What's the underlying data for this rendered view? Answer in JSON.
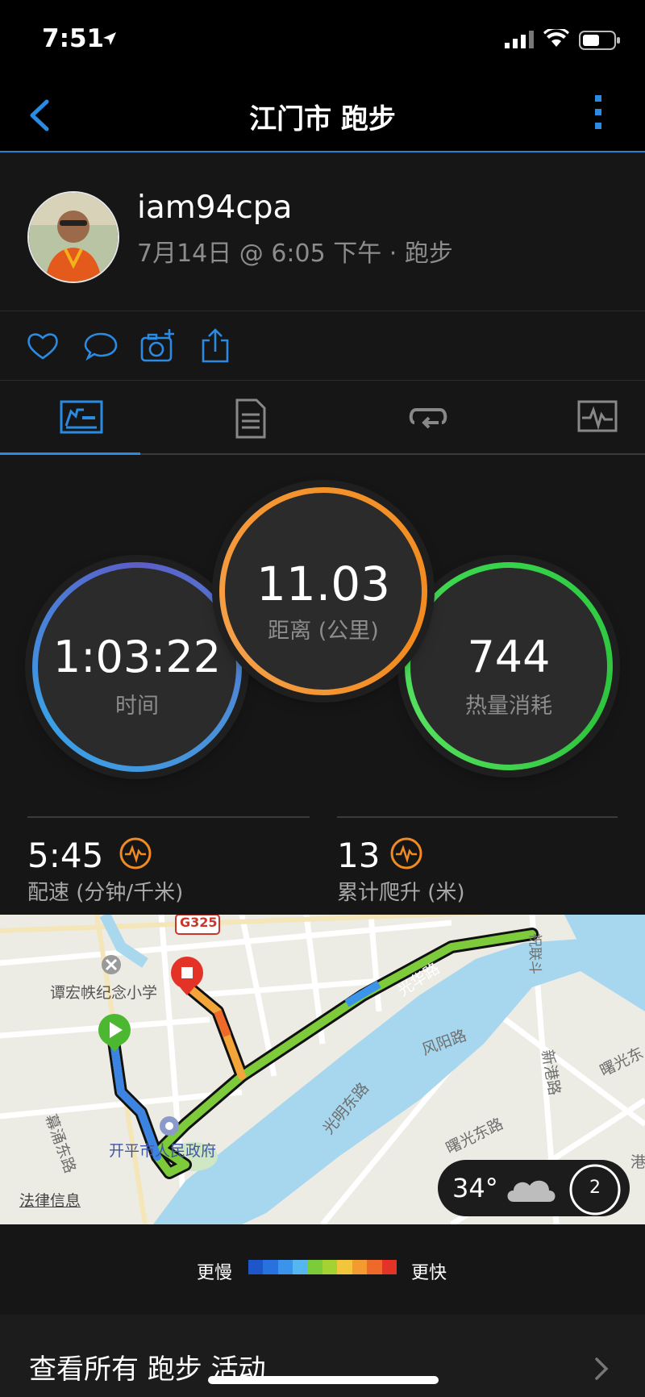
{
  "status": {
    "time": "7:51"
  },
  "header": {
    "title": "江门市 跑步"
  },
  "profile": {
    "username": "iam94cpa",
    "meta": "7月14日 @ 6:05 下午 · 跑步"
  },
  "actions": [
    "like-icon",
    "comment-icon",
    "add-photo-icon",
    "share-icon"
  ],
  "tabs": [
    "summary-tab",
    "details-tab",
    "laps-tab",
    "charts-tab"
  ],
  "stats": {
    "time": {
      "value": "1:03:22",
      "label": "时间"
    },
    "distance": {
      "value": "11.03",
      "label": "距离 (公里)"
    },
    "calories": {
      "value": "744",
      "label": "热量消耗"
    }
  },
  "metrics": {
    "pace": {
      "value": "5:45",
      "label": "配速 (分钟/千米)"
    },
    "ascent": {
      "value": "13",
      "label": "累计爬升 (米)"
    }
  },
  "map": {
    "labels": {
      "road_g325": "G325",
      "school": "谭宏帙纪念小学",
      "guanghua": "光华路",
      "fengyang": "风阳路",
      "guangming": "光明东路",
      "xingang": "新港路",
      "shuguang1": "曙光东路",
      "shuguang2": "曙光东",
      "gov": "开平市人民政府",
      "mupu": "幕涌东路",
      "legal": "法律信息",
      "bridge": "祝联斗",
      "gang": "港"
    },
    "weather": {
      "temp": "34°",
      "badge": "2"
    }
  },
  "legend": {
    "slow": "更慢",
    "fast": "更快",
    "colors": [
      "#1e55c8",
      "#2872e0",
      "#3b93ea",
      "#56b7f0",
      "#7ccb3a",
      "#a4d233",
      "#f3c53b",
      "#f39a30",
      "#ef6a2a",
      "#e33226"
    ]
  },
  "footer": {
    "view_all": "查看所有 跑步 活动"
  }
}
